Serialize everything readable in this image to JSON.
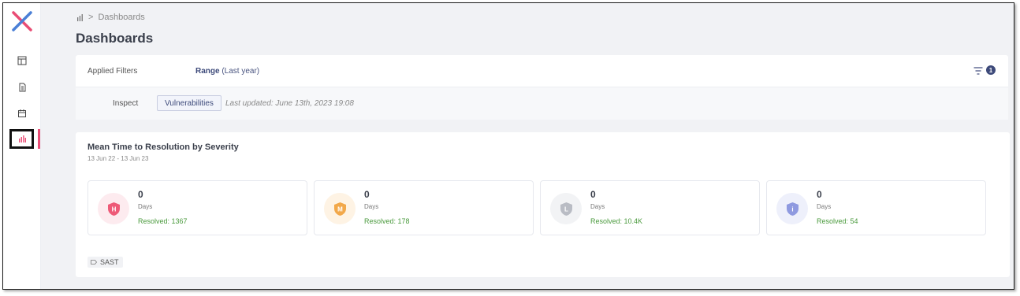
{
  "breadcrumb": {
    "separator": ">",
    "current": "Dashboards"
  },
  "page": {
    "title": "Dashboards"
  },
  "filters": {
    "applied_label": "Applied Filters",
    "range_label": "Range",
    "range_value": "(Last year)",
    "badge_count": "1",
    "inspect_label": "Inspect",
    "inspect_value": "Vulnerabilities",
    "last_updated": "Last updated: June 13th, 2023 19:08"
  },
  "mttr": {
    "title": "Mean Time to Resolution by Severity",
    "dates": "13 Jun 22 - 13 Jun 23",
    "cards": [
      {
        "severity": "High",
        "letter": "H",
        "value": "0",
        "unit": "Days",
        "resolved": "Resolved: 1367",
        "color": "#ee5a78",
        "bg": "#fdebef"
      },
      {
        "severity": "Medium",
        "letter": "M",
        "value": "0",
        "unit": "Days",
        "resolved": "Resolved: 178",
        "color": "#f2a84a",
        "bg": "#fef3e4"
      },
      {
        "severity": "Low",
        "letter": "L",
        "value": "0",
        "unit": "Days",
        "resolved": "Resolved: 10.4K",
        "color": "#b9bcc4",
        "bg": "#f2f3f5"
      },
      {
        "severity": "Info",
        "letter": "i",
        "value": "0",
        "unit": "Days",
        "resolved": "Resolved: 54",
        "color": "#8f9ae0",
        "bg": "#eef0fb"
      }
    ],
    "tag": "SAST"
  },
  "sidebar": {
    "items": [
      {
        "icon": "dashboard-layout-icon"
      },
      {
        "icon": "document-icon"
      },
      {
        "icon": "calendar-icon"
      },
      {
        "icon": "bar-chart-icon",
        "active": true
      }
    ]
  },
  "colors": {
    "accent": "#e94c74",
    "brand_blue": "#3d4a7a",
    "resolved_green": "#4a9a3d"
  }
}
